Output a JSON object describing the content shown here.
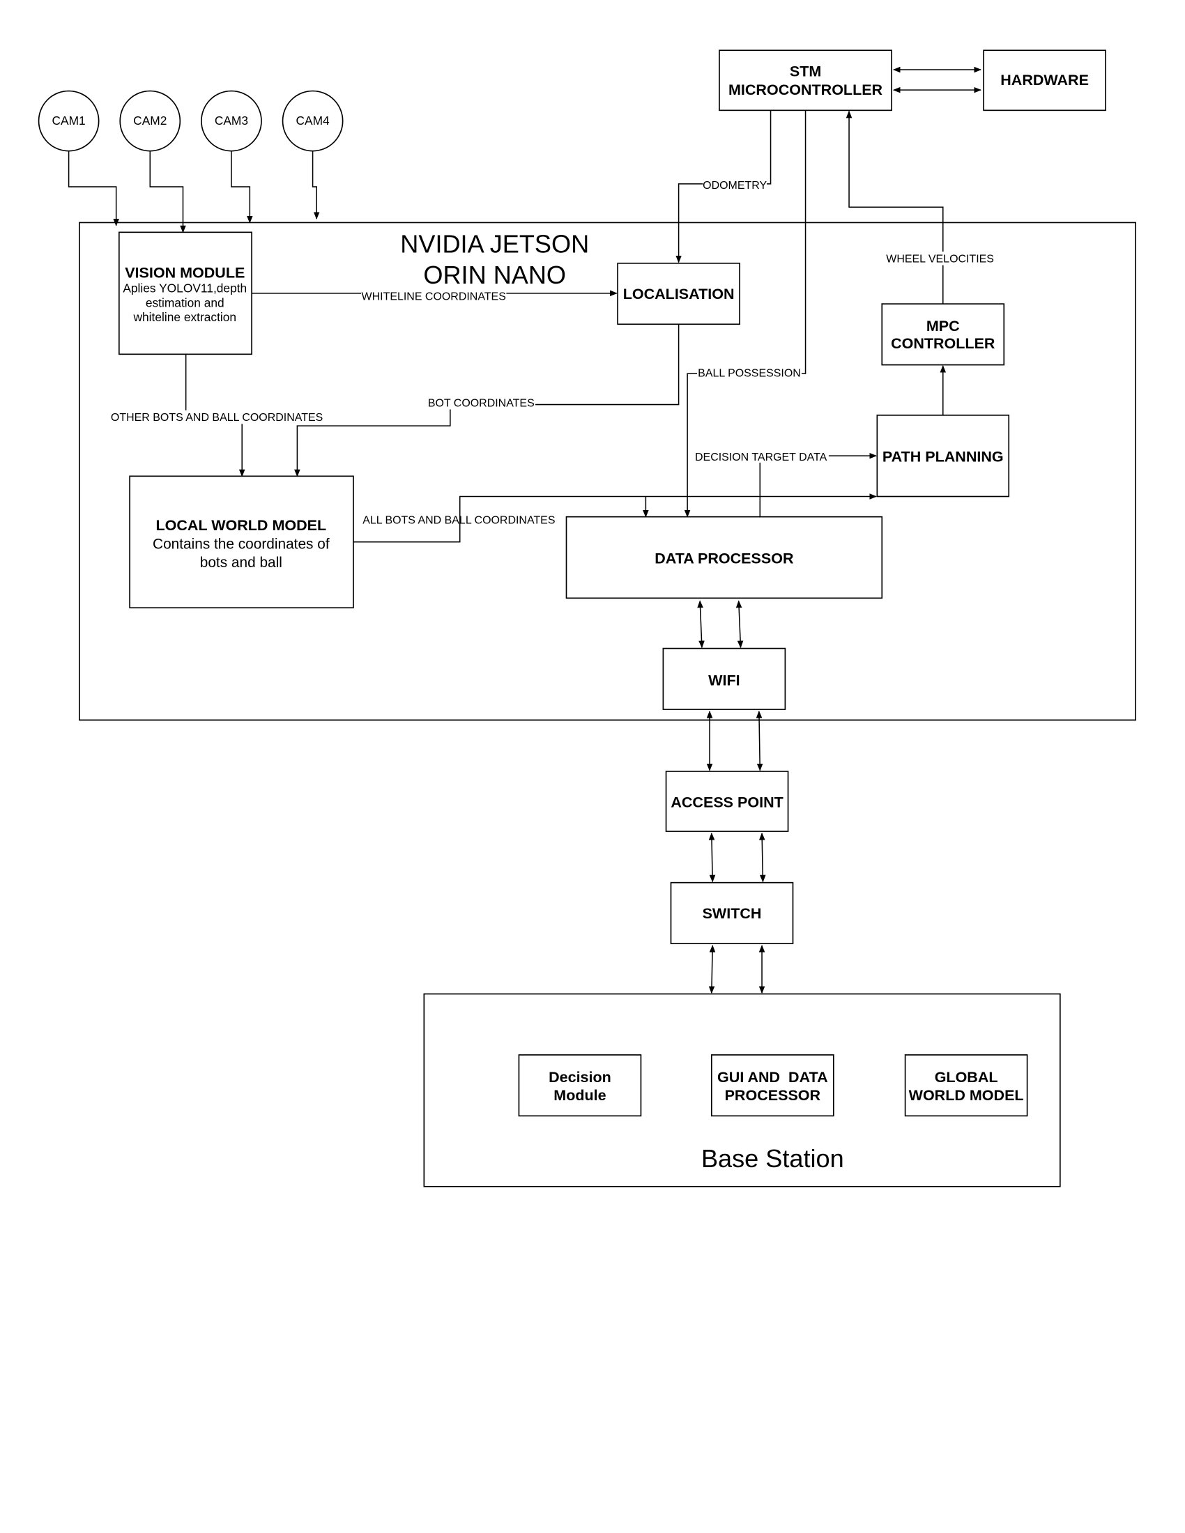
{
  "cameras": [
    "CAM1",
    "CAM2",
    "CAM3",
    "CAM4"
  ],
  "jetson": {
    "title_line1": "NVIDIA JETSON",
    "title_line2": "ORIN NANO"
  },
  "vision": {
    "title": "VISION MODULE",
    "desc1": "Aplies YOLOV11,depth",
    "desc2": "estimation and",
    "desc3": "whiteline extraction"
  },
  "localisation": "LOCALISATION",
  "stm": {
    "line1": "STM",
    "line2": "MICROCONTROLLER"
  },
  "hardware": "HARDWARE",
  "mpc": {
    "line1": "MPC",
    "line2": "CONTROLLER"
  },
  "path_planning": "PATH PLANNING",
  "local_world_model": {
    "title": "LOCAL WORLD MODEL",
    "desc1": "Contains the coordinates of",
    "desc2": "bots and ball"
  },
  "data_processor": "DATA PROCESSOR",
  "wifi": "WIFI",
  "access_point": "ACCESS POINT",
  "switch": "SWITCH",
  "base_station": {
    "title": "Base Station",
    "decision": {
      "line1": "Decision",
      "line2": "Module"
    },
    "gui": {
      "line1": "GUI AND  DATA",
      "line2": "PROCESSOR"
    },
    "global": {
      "line1": "GLOBAL",
      "line2": "WORLD MODEL"
    }
  },
  "edge_labels": {
    "whiteline": "WHITELINE COORDINATES",
    "odometry": "ODOMETRY",
    "ball_possession": "BALL POSSESSION",
    "wheel_velocities": "WHEEL VELOCITIES",
    "bot_coordinates": "BOT COORDINATES",
    "other_bots": "OTHER BOTS AND BALL COORDINATES",
    "decision_target": "DECISION TARGET DATA",
    "all_bots": "ALL BOTS AND BALL COORDINATES"
  }
}
